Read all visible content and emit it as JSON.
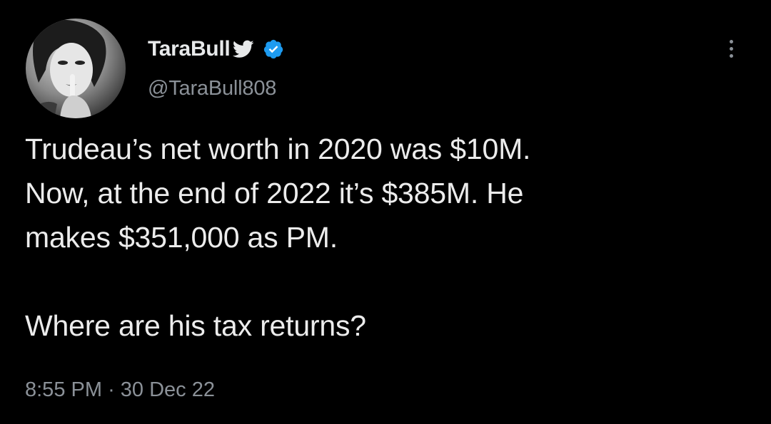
{
  "tweet": {
    "author": {
      "display_name": "TaraBull",
      "handle": "@TaraBull808",
      "avatar_icon": "avatar-photo",
      "verified": true,
      "verified_color": "#1d9bf0",
      "bird_icon": "twitter-bird-icon"
    },
    "text_lines": [
      "Trudeau’s net worth in 2020 was $10M.",
      "Now, at the end of 2022 it’s $385M. He",
      "makes $351,000 as PM.",
      "",
      "Where are his tax returns?"
    ],
    "time": "8:55 PM",
    "separator": "·",
    "date": "30 Dec 22",
    "more_icon": "more-options-icon"
  },
  "colors": {
    "background": "#000000",
    "primary_text": "#e7e9ea",
    "secondary_text": "#8b9198",
    "verified_blue": "#1d9bf0"
  }
}
